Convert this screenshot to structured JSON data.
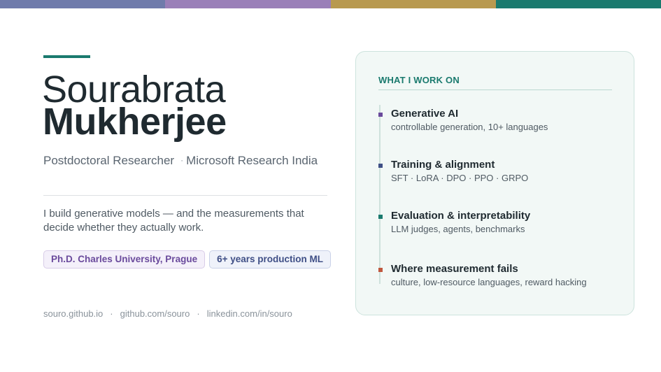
{
  "colors": {
    "bar": [
      "#6f7bab",
      "#9a7fb8",
      "#b8994f",
      "#1a7a6e"
    ],
    "accent": "#1a7a6e",
    "markers": [
      "#6a4a9c",
      "#3f4f86",
      "#1a7a6e",
      "#c0583f"
    ]
  },
  "profile": {
    "first_name": "Sourabrata",
    "last_name": "Mukherjee",
    "role": "Postdoctoral Researcher",
    "separator": "·",
    "org": "Microsoft Research India",
    "pitch": "I build generative models — and the measurements that decide whether they actually work.",
    "badges": [
      "Ph.D. Charles University, Prague",
      "6+ years production ML"
    ]
  },
  "footer": {
    "links": [
      "souro.github.io",
      "github.com/souro",
      "linkedin.com/in/souro"
    ],
    "separator": "·"
  },
  "work": {
    "title": "WHAT I WORK ON",
    "items": [
      {
        "title": "Generative AI",
        "desc": "controllable generation, 10+ languages"
      },
      {
        "title": "Training & alignment",
        "desc": "SFT · LoRA · DPO · PPO · GRPO"
      },
      {
        "title": "Evaluation & interpretability",
        "desc": "LLM judges, agents, benchmarks"
      },
      {
        "title": "Where measurement fails",
        "desc": "culture, low-resource languages, reward hacking"
      }
    ]
  }
}
